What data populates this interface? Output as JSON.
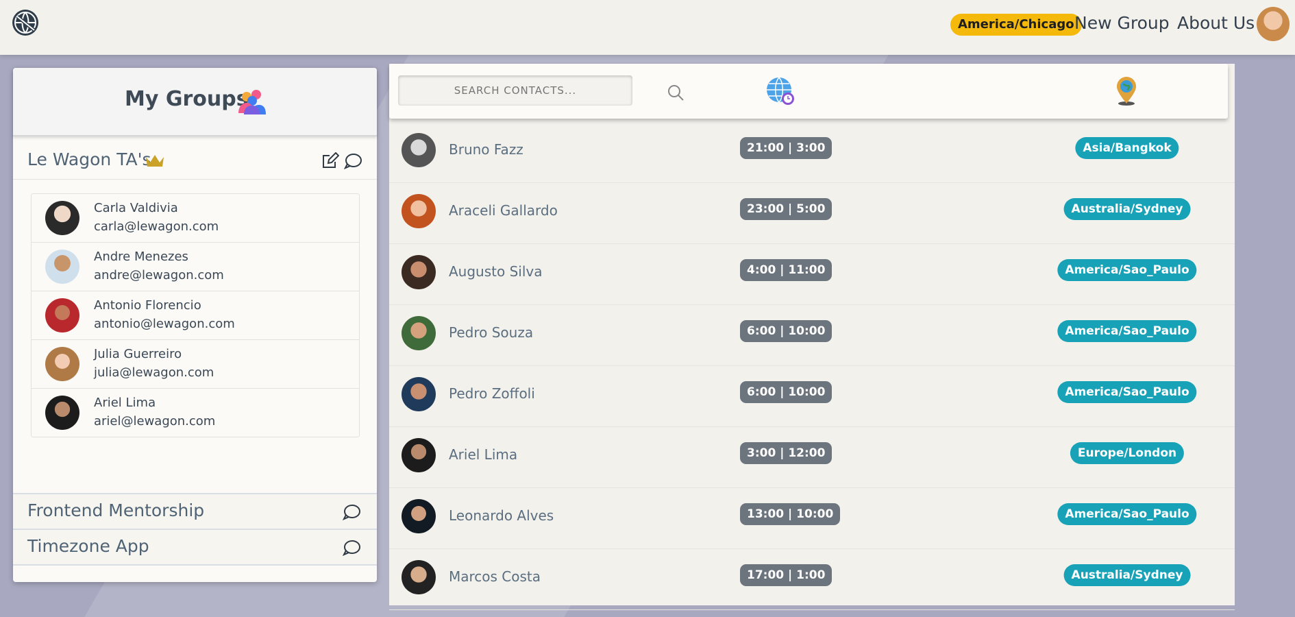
{
  "navbar": {
    "timezone": "America/Chicago",
    "new_group": "New Group",
    "about_us": "About Us"
  },
  "groups_panel": {
    "title": "My Groups",
    "active_group": {
      "name": "Le Wagon TA's",
      "members": [
        {
          "name": "Carla Valdivia",
          "email": "carla@lewagon.com"
        },
        {
          "name": "Andre Menezes",
          "email": "andre@lewagon.com"
        },
        {
          "name": "Antonio Florencio",
          "email": "antonio@lewagon.com"
        },
        {
          "name": "Julia Guerreiro",
          "email": "julia@lewagon.com"
        },
        {
          "name": "Ariel Lima",
          "email": "ariel@lewagon.com"
        }
      ]
    },
    "other_groups": [
      {
        "name": "Frontend Mentorship"
      },
      {
        "name": "Timezone App"
      }
    ]
  },
  "contacts": {
    "search_placeholder": "SEARCH CONTACTS...",
    "rows": [
      {
        "name": "Bruno Fazz",
        "time": "21:00 | 3:00",
        "timezone": "Asia/Bangkok"
      },
      {
        "name": "Araceli Gallardo",
        "time": "23:00 | 5:00",
        "timezone": "Australia/Sydney"
      },
      {
        "name": "Augusto Silva",
        "time": "4:00 | 11:00",
        "timezone": "America/Sao_Paulo"
      },
      {
        "name": "Pedro Souza",
        "time": "6:00 | 10:00",
        "timezone": "America/Sao_Paulo"
      },
      {
        "name": "Pedro Zoffoli",
        "time": "6:00 | 10:00",
        "timezone": "America/Sao_Paulo"
      },
      {
        "name": "Ariel Lima",
        "time": "3:00 | 12:00",
        "timezone": "Europe/London"
      },
      {
        "name": "Leonardo Alves",
        "time": "13:00 | 10:00",
        "timezone": "America/Sao_Paulo"
      },
      {
        "name": "Marcos Costa",
        "time": "17:00 | 1:00",
        "timezone": "Australia/Sydney"
      }
    ]
  },
  "colors": {
    "timezone_badge": "#f5b90b",
    "time_badge": "#6c757d",
    "zone_badge": "#17a2b8"
  }
}
